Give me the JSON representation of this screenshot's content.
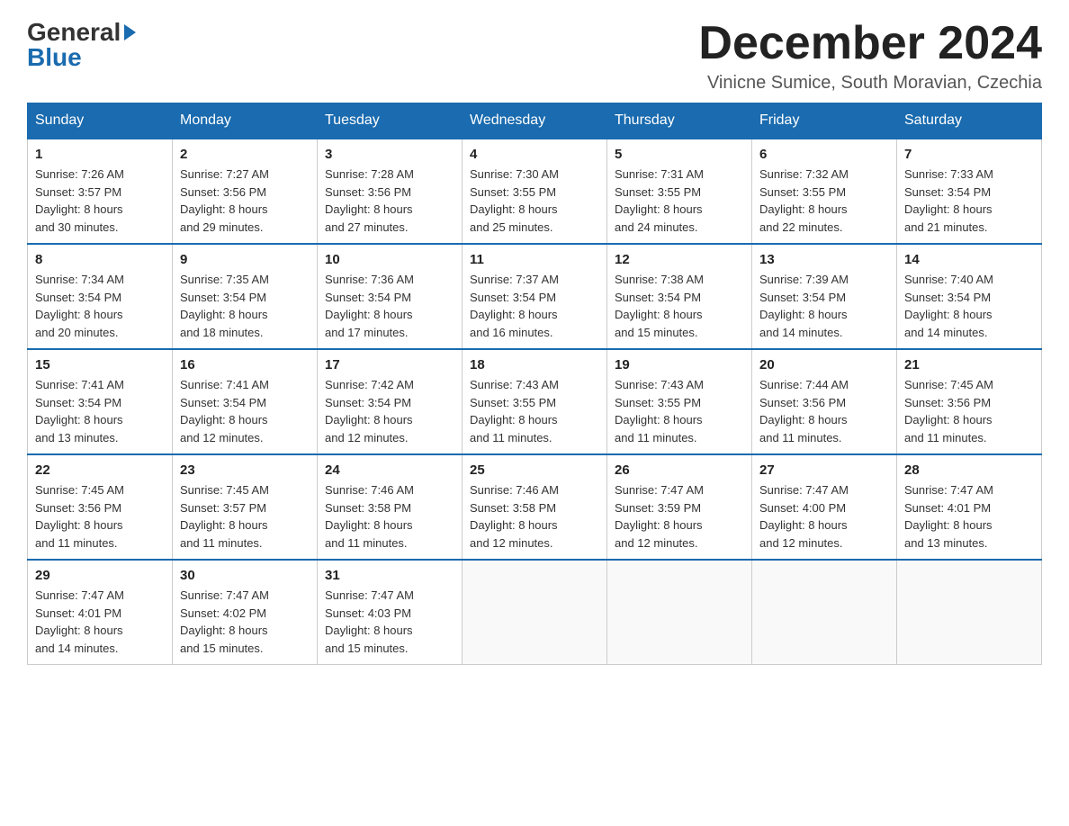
{
  "logo": {
    "line1": "General",
    "line2": "Blue",
    "arrow": "▶"
  },
  "header": {
    "month_title": "December 2024",
    "location": "Vinicne Sumice, South Moravian, Czechia"
  },
  "weekdays": [
    "Sunday",
    "Monday",
    "Tuesday",
    "Wednesday",
    "Thursday",
    "Friday",
    "Saturday"
  ],
  "weeks": [
    [
      {
        "day": "1",
        "sunrise": "Sunrise: 7:26 AM",
        "sunset": "Sunset: 3:57 PM",
        "daylight": "Daylight: 8 hours",
        "daylight2": "and 30 minutes."
      },
      {
        "day": "2",
        "sunrise": "Sunrise: 7:27 AM",
        "sunset": "Sunset: 3:56 PM",
        "daylight": "Daylight: 8 hours",
        "daylight2": "and 29 minutes."
      },
      {
        "day": "3",
        "sunrise": "Sunrise: 7:28 AM",
        "sunset": "Sunset: 3:56 PM",
        "daylight": "Daylight: 8 hours",
        "daylight2": "and 27 minutes."
      },
      {
        "day": "4",
        "sunrise": "Sunrise: 7:30 AM",
        "sunset": "Sunset: 3:55 PM",
        "daylight": "Daylight: 8 hours",
        "daylight2": "and 25 minutes."
      },
      {
        "day": "5",
        "sunrise": "Sunrise: 7:31 AM",
        "sunset": "Sunset: 3:55 PM",
        "daylight": "Daylight: 8 hours",
        "daylight2": "and 24 minutes."
      },
      {
        "day": "6",
        "sunrise": "Sunrise: 7:32 AM",
        "sunset": "Sunset: 3:55 PM",
        "daylight": "Daylight: 8 hours",
        "daylight2": "and 22 minutes."
      },
      {
        "day": "7",
        "sunrise": "Sunrise: 7:33 AM",
        "sunset": "Sunset: 3:54 PM",
        "daylight": "Daylight: 8 hours",
        "daylight2": "and 21 minutes."
      }
    ],
    [
      {
        "day": "8",
        "sunrise": "Sunrise: 7:34 AM",
        "sunset": "Sunset: 3:54 PM",
        "daylight": "Daylight: 8 hours",
        "daylight2": "and 20 minutes."
      },
      {
        "day": "9",
        "sunrise": "Sunrise: 7:35 AM",
        "sunset": "Sunset: 3:54 PM",
        "daylight": "Daylight: 8 hours",
        "daylight2": "and 18 minutes."
      },
      {
        "day": "10",
        "sunrise": "Sunrise: 7:36 AM",
        "sunset": "Sunset: 3:54 PM",
        "daylight": "Daylight: 8 hours",
        "daylight2": "and 17 minutes."
      },
      {
        "day": "11",
        "sunrise": "Sunrise: 7:37 AM",
        "sunset": "Sunset: 3:54 PM",
        "daylight": "Daylight: 8 hours",
        "daylight2": "and 16 minutes."
      },
      {
        "day": "12",
        "sunrise": "Sunrise: 7:38 AM",
        "sunset": "Sunset: 3:54 PM",
        "daylight": "Daylight: 8 hours",
        "daylight2": "and 15 minutes."
      },
      {
        "day": "13",
        "sunrise": "Sunrise: 7:39 AM",
        "sunset": "Sunset: 3:54 PM",
        "daylight": "Daylight: 8 hours",
        "daylight2": "and 14 minutes."
      },
      {
        "day": "14",
        "sunrise": "Sunrise: 7:40 AM",
        "sunset": "Sunset: 3:54 PM",
        "daylight": "Daylight: 8 hours",
        "daylight2": "and 14 minutes."
      }
    ],
    [
      {
        "day": "15",
        "sunrise": "Sunrise: 7:41 AM",
        "sunset": "Sunset: 3:54 PM",
        "daylight": "Daylight: 8 hours",
        "daylight2": "and 13 minutes."
      },
      {
        "day": "16",
        "sunrise": "Sunrise: 7:41 AM",
        "sunset": "Sunset: 3:54 PM",
        "daylight": "Daylight: 8 hours",
        "daylight2": "and 12 minutes."
      },
      {
        "day": "17",
        "sunrise": "Sunrise: 7:42 AM",
        "sunset": "Sunset: 3:54 PM",
        "daylight": "Daylight: 8 hours",
        "daylight2": "and 12 minutes."
      },
      {
        "day": "18",
        "sunrise": "Sunrise: 7:43 AM",
        "sunset": "Sunset: 3:55 PM",
        "daylight": "Daylight: 8 hours",
        "daylight2": "and 11 minutes."
      },
      {
        "day": "19",
        "sunrise": "Sunrise: 7:43 AM",
        "sunset": "Sunset: 3:55 PM",
        "daylight": "Daylight: 8 hours",
        "daylight2": "and 11 minutes."
      },
      {
        "day": "20",
        "sunrise": "Sunrise: 7:44 AM",
        "sunset": "Sunset: 3:56 PM",
        "daylight": "Daylight: 8 hours",
        "daylight2": "and 11 minutes."
      },
      {
        "day": "21",
        "sunrise": "Sunrise: 7:45 AM",
        "sunset": "Sunset: 3:56 PM",
        "daylight": "Daylight: 8 hours",
        "daylight2": "and 11 minutes."
      }
    ],
    [
      {
        "day": "22",
        "sunrise": "Sunrise: 7:45 AM",
        "sunset": "Sunset: 3:56 PM",
        "daylight": "Daylight: 8 hours",
        "daylight2": "and 11 minutes."
      },
      {
        "day": "23",
        "sunrise": "Sunrise: 7:45 AM",
        "sunset": "Sunset: 3:57 PM",
        "daylight": "Daylight: 8 hours",
        "daylight2": "and 11 minutes."
      },
      {
        "day": "24",
        "sunrise": "Sunrise: 7:46 AM",
        "sunset": "Sunset: 3:58 PM",
        "daylight": "Daylight: 8 hours",
        "daylight2": "and 11 minutes."
      },
      {
        "day": "25",
        "sunrise": "Sunrise: 7:46 AM",
        "sunset": "Sunset: 3:58 PM",
        "daylight": "Daylight: 8 hours",
        "daylight2": "and 12 minutes."
      },
      {
        "day": "26",
        "sunrise": "Sunrise: 7:47 AM",
        "sunset": "Sunset: 3:59 PM",
        "daylight": "Daylight: 8 hours",
        "daylight2": "and 12 minutes."
      },
      {
        "day": "27",
        "sunrise": "Sunrise: 7:47 AM",
        "sunset": "Sunset: 4:00 PM",
        "daylight": "Daylight: 8 hours",
        "daylight2": "and 12 minutes."
      },
      {
        "day": "28",
        "sunrise": "Sunrise: 7:47 AM",
        "sunset": "Sunset: 4:01 PM",
        "daylight": "Daylight: 8 hours",
        "daylight2": "and 13 minutes."
      }
    ],
    [
      {
        "day": "29",
        "sunrise": "Sunrise: 7:47 AM",
        "sunset": "Sunset: 4:01 PM",
        "daylight": "Daylight: 8 hours",
        "daylight2": "and 14 minutes."
      },
      {
        "day": "30",
        "sunrise": "Sunrise: 7:47 AM",
        "sunset": "Sunset: 4:02 PM",
        "daylight": "Daylight: 8 hours",
        "daylight2": "and 15 minutes."
      },
      {
        "day": "31",
        "sunrise": "Sunrise: 7:47 AM",
        "sunset": "Sunset: 4:03 PM",
        "daylight": "Daylight: 8 hours",
        "daylight2": "and 15 minutes."
      },
      {
        "day": "",
        "sunrise": "",
        "sunset": "",
        "daylight": "",
        "daylight2": ""
      },
      {
        "day": "",
        "sunrise": "",
        "sunset": "",
        "daylight": "",
        "daylight2": ""
      },
      {
        "day": "",
        "sunrise": "",
        "sunset": "",
        "daylight": "",
        "daylight2": ""
      },
      {
        "day": "",
        "sunrise": "",
        "sunset": "",
        "daylight": "",
        "daylight2": ""
      }
    ]
  ]
}
